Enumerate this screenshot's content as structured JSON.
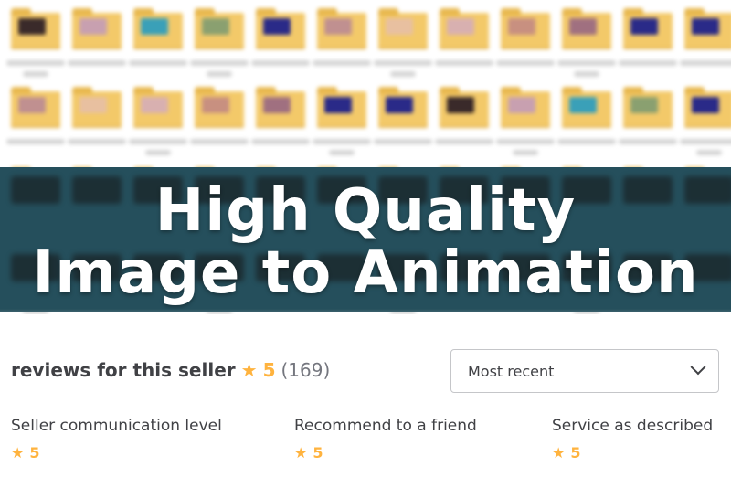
{
  "banner": {
    "line1": "High Quality",
    "line2": "Image to Animation"
  },
  "reviews": {
    "heading": "reviews for this seller",
    "star_icon": "star-icon",
    "rating": "5",
    "count": "(169)"
  },
  "sort": {
    "selected": "Most recent"
  },
  "metrics": [
    {
      "label": "Seller communication level",
      "value": "5"
    },
    {
      "label": "Recommend to a friend",
      "value": "5"
    },
    {
      "label": "Service as described",
      "value": "5"
    }
  ],
  "colors": {
    "accent_star": "#ffb33e",
    "banner_bg": "#254f5c",
    "folder": "#f3c969",
    "text": "#404145"
  }
}
